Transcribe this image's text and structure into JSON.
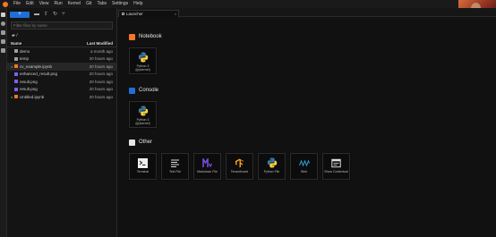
{
  "menubar": {
    "items": [
      "File",
      "Edit",
      "View",
      "Run",
      "Kernel",
      "Git",
      "Tabs",
      "Settings",
      "Help"
    ]
  },
  "filebrowser": {
    "new_label": "+",
    "filter_placeholder": "Filter files by name",
    "breadcrumb": "▰ /",
    "columns": {
      "name": "Name",
      "modified": "Last Modified"
    },
    "files": [
      {
        "name": "demo",
        "modified": "a month ago",
        "icon": "folder-icon",
        "color": "#9aa0a6"
      },
      {
        "name": "temp",
        "modified": "20 hours ago",
        "icon": "folder-icon",
        "color": "#9aa0a6"
      },
      {
        "name": "cv_example.ipynb",
        "modified": "20 hours ago",
        "icon": "notebook-icon",
        "color": "#f37726",
        "running": true,
        "selected": true
      },
      {
        "name": "enhanced_result.png",
        "modified": "20 hours ago",
        "icon": "image-icon",
        "color": "#7b61ff"
      },
      {
        "name": "result.png",
        "modified": "20 hours ago",
        "icon": "image-icon",
        "color": "#7b61ff"
      },
      {
        "name": "result.png",
        "modified": "20 hours ago",
        "icon": "image-icon",
        "color": "#7b61ff"
      },
      {
        "name": "Untitled.ipynb",
        "modified": "20 hours ago",
        "icon": "notebook-icon",
        "color": "#f37726",
        "running": true
      }
    ]
  },
  "tab": {
    "label": "Launcher",
    "close": "×"
  },
  "launcher": {
    "notebook": {
      "title": "Notebook",
      "cards": [
        {
          "label": "Python 3 (ipykernel)"
        }
      ]
    },
    "console": {
      "title": "Console",
      "cards": [
        {
          "label": "Python 3 (ipykernel)"
        }
      ]
    },
    "other": {
      "title": "Other",
      "cards": [
        {
          "label": "Terminal"
        },
        {
          "label": "Text File"
        },
        {
          "label": "Markdown File"
        },
        {
          "label": "Tensorboard"
        },
        {
          "label": "Python File"
        },
        {
          "label": "Web"
        },
        {
          "label": "Show Contextual"
        }
      ]
    }
  },
  "colors": {
    "accent": "#1f6fd8",
    "notebook_orange": "#f37726",
    "console_blue": "#1f6fd8",
    "markdown_purple": "#7b4ae0"
  }
}
